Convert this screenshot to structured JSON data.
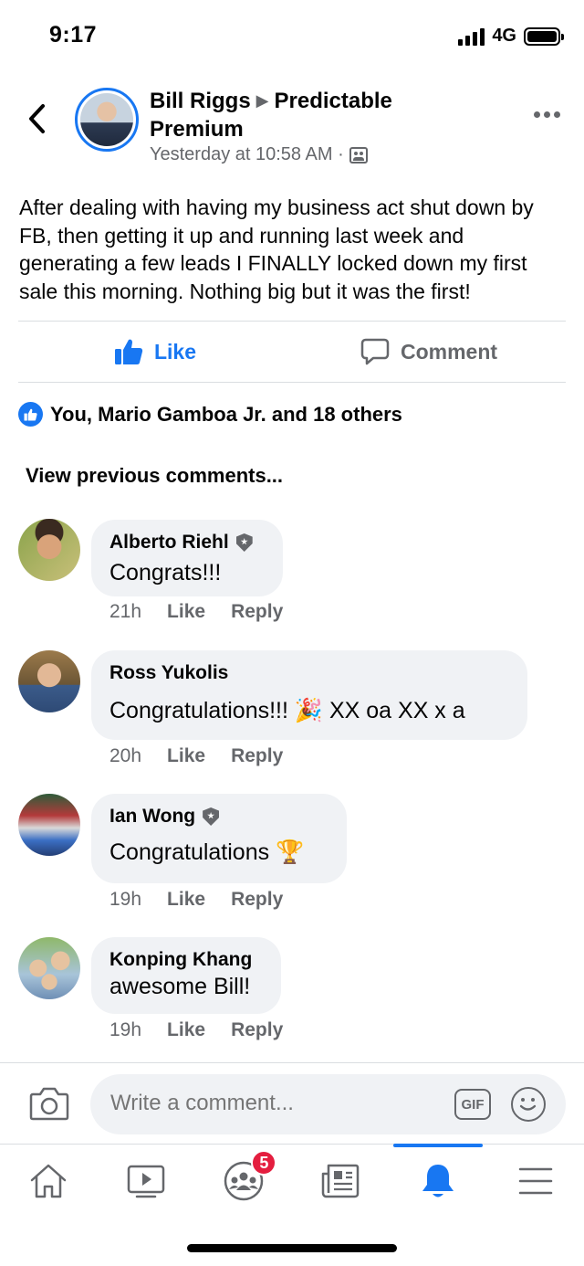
{
  "status_bar": {
    "time": "9:17",
    "network": "4G"
  },
  "post": {
    "author": "Bill Riggs",
    "group": "Predictable Premium",
    "timestamp": "Yesterday at 10:58 AM ·",
    "text": "After dealing with having my business act shut down by FB, then getting it up and running last week and generating a few leads I FINALLY locked down my first sale this morning.  Nothing big but it was the first!"
  },
  "actions": {
    "like_label": "Like",
    "comment_label": "Comment"
  },
  "reactions": {
    "summary": "You, Mario Gamboa Jr. and 18 others"
  },
  "view_previous": "View previous comments...",
  "comments": [
    {
      "name": "Alberto Riehl",
      "text": "Congrats!!!",
      "time": "21h",
      "like": "Like",
      "reply": "Reply",
      "badge": true,
      "emoji": ""
    },
    {
      "name": "Ross Yukolis",
      "text": "Congratulations!!! 🎉  XX oa XX x a",
      "time": "20h",
      "like": "Like",
      "reply": "Reply",
      "badge": false,
      "emoji": "party-popper"
    },
    {
      "name": "Ian Wong",
      "text": "Congratulations 🏆",
      "time": "19h",
      "like": "Like",
      "reply": "Reply",
      "badge": true,
      "emoji": "trophy"
    },
    {
      "name": "Konping Khang",
      "text": "awesome Bill!",
      "time": "19h",
      "like": "Like",
      "reply": "Reply",
      "badge": false,
      "emoji": ""
    }
  ],
  "composer": {
    "placeholder": "Write a comment...",
    "gif_label": "GIF"
  },
  "tab_bar": {
    "groups_badge": "5",
    "active_tab": "notifications"
  },
  "colors": {
    "accent": "#1877f2",
    "secondary_text": "#65676b",
    "bubble": "#f0f2f5",
    "badge_red": "#e41e3f"
  }
}
